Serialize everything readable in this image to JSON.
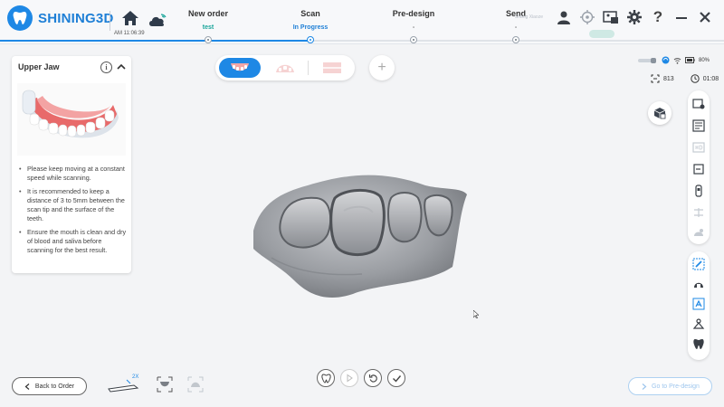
{
  "app": {
    "brand": "SHINING3D",
    "time": "AM 11:06:39",
    "user": "Shang Xiaoze",
    "badge": ""
  },
  "steps": [
    {
      "title": "New order",
      "status": "test"
    },
    {
      "title": "Scan",
      "status": "In Progress"
    },
    {
      "title": "Pre-design",
      "status": "-"
    },
    {
      "title": "Send",
      "status": "-"
    }
  ],
  "panel": {
    "title": "Upper Jaw",
    "tips": [
      "Please keep moving at a constant speed while scanning.",
      "It is recommended to keep a distance of 3 to 5mm between the scan tip and the surface of the teeth.",
      "Ensure the mouth is clean and dry of blood and saliva before scanning for the best result."
    ]
  },
  "status": {
    "battery": "80%",
    "count": "813",
    "duration": "01:08"
  },
  "bottom": {
    "back_label": "Back to Order",
    "next_label": "Go to Pre-design",
    "tip_size": "2X"
  },
  "colors": {
    "accent": "#1e88e5",
    "done": "#1aa59a"
  }
}
